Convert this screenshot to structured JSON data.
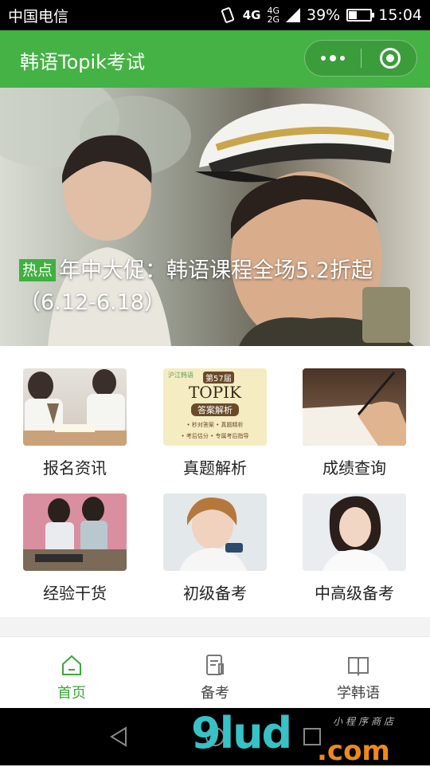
{
  "status_bar": {
    "carrier": "中国电信",
    "network": "4G",
    "network_small_top": "4G",
    "network_small_bottom": "2G",
    "battery_percent": "39%",
    "battery_level": 0.39,
    "time": "15:04"
  },
  "title_bar": {
    "title": "韩语Topik考试",
    "more_icon": "more-dots-icon",
    "close_icon": "circle-close-icon",
    "color": "#44b244"
  },
  "banner": {
    "tag": "热点",
    "headline": "年中大促：韩语课程全场5.2折起（6.12-6.18）"
  },
  "grid": {
    "items": [
      {
        "label": "报名资讯",
        "thumb_icon": "students-writing-photo"
      },
      {
        "label": "真题解析",
        "thumb_icon": "topik-book-cover",
        "thumb_badge": "第57届",
        "thumb_title": "TOPIK",
        "thumb_subtitle": "答案解析",
        "thumb_line1": "• 秒对答案 • 真题精析",
        "thumb_line2": "• 考后估分 • 专属考后指导",
        "thumb_brand": "沪江韩语"
      },
      {
        "label": "成绩查询",
        "thumb_icon": "hand-writing-photo"
      },
      {
        "label": "经验干货",
        "thumb_icon": "two-people-sofa-photo"
      },
      {
        "label": "初级备考",
        "thumb_icon": "portrait-man-photo"
      },
      {
        "label": "中高级备考",
        "thumb_icon": "portrait-woman-photo"
      }
    ]
  },
  "tab_bar": {
    "tabs": [
      {
        "label": "首页",
        "icon": "home-icon",
        "active": true
      },
      {
        "label": "备考",
        "icon": "notes-icon",
        "active": false
      },
      {
        "label": "学韩语",
        "icon": "book-icon",
        "active": false
      }
    ],
    "active_color": "#3aa83a"
  },
  "nav_bar": {
    "back_icon": "back-triangle-icon",
    "home_icon": "home-circle-icon",
    "recents_icon": "recents-square-icon"
  },
  "watermark": {
    "main": "9lud",
    "suffix": ".com",
    "small": "小程序商店"
  }
}
